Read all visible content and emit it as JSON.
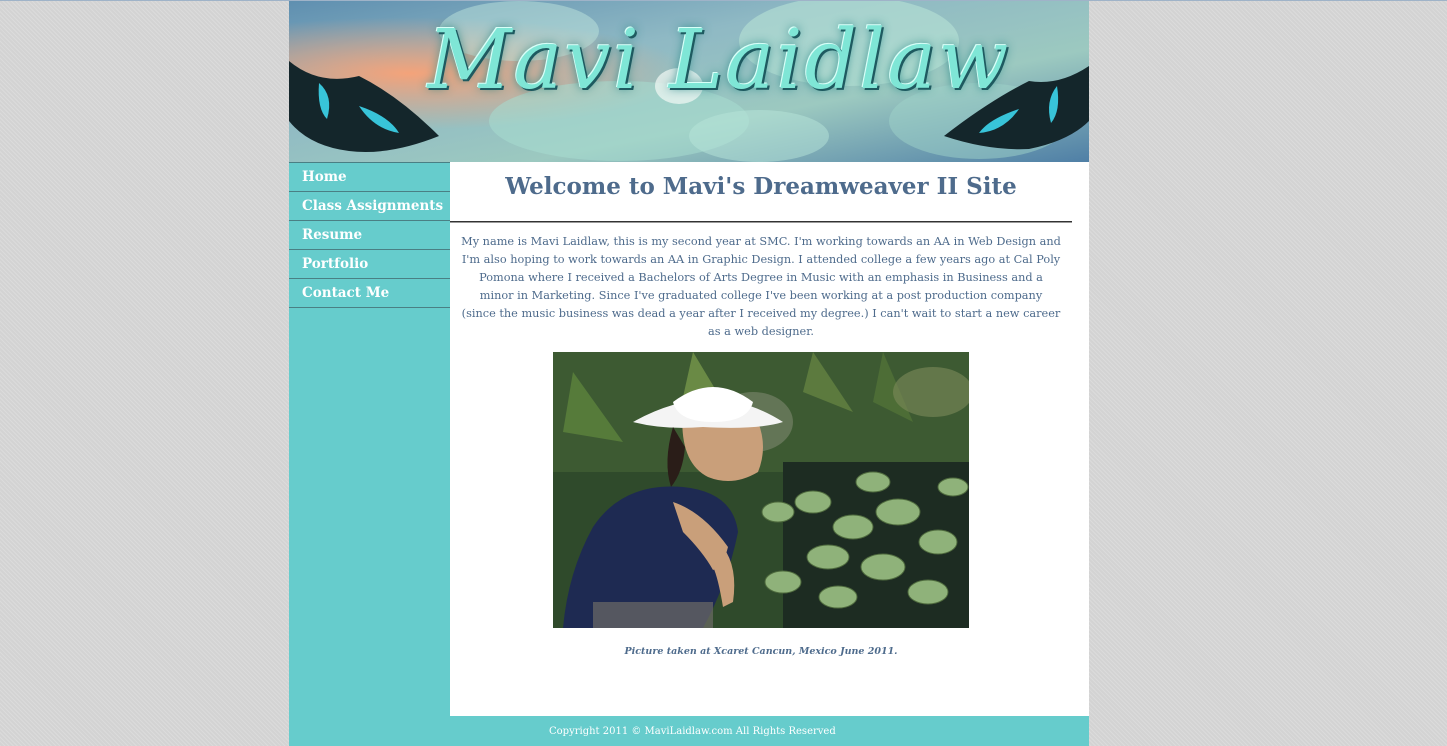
{
  "site": {
    "logo_text": "Mavi Laidlaw"
  },
  "nav": {
    "items": [
      {
        "label": "Home"
      },
      {
        "label": "Class Assignments"
      },
      {
        "label": "Resume"
      },
      {
        "label": "Portfolio"
      },
      {
        "label": "Contact Me"
      }
    ]
  },
  "main": {
    "heading": "Welcome to Mavi's Dreamweaver II Site",
    "intro": "My name is Mavi Laidlaw, this is my second year at SMC. I'm working towards an AA in Web Design and I'm also hoping to work towards an AA in Graphic Design. I attended college a few years ago at Cal Poly Pomona where I received a Bachelors of Arts Degree in Music with an emphasis in Business and a minor in Marketing. Since I've graduated college I've been working at a post production company (since the music business was dead a year after I received my degree.) I can't wait to start a new career as a web designer.",
    "photo_caption": "Picture taken at Xcaret Cancun, Mexico June 2011."
  },
  "footer": {
    "copyright": "Copyright 2011 © MaviLaidlaw.com All Rights Reserved"
  },
  "colors": {
    "page_background": "#d3d3d3",
    "sidebar": "#66cccc",
    "text": "#4e6b8c",
    "content_background": "#ffffff"
  }
}
